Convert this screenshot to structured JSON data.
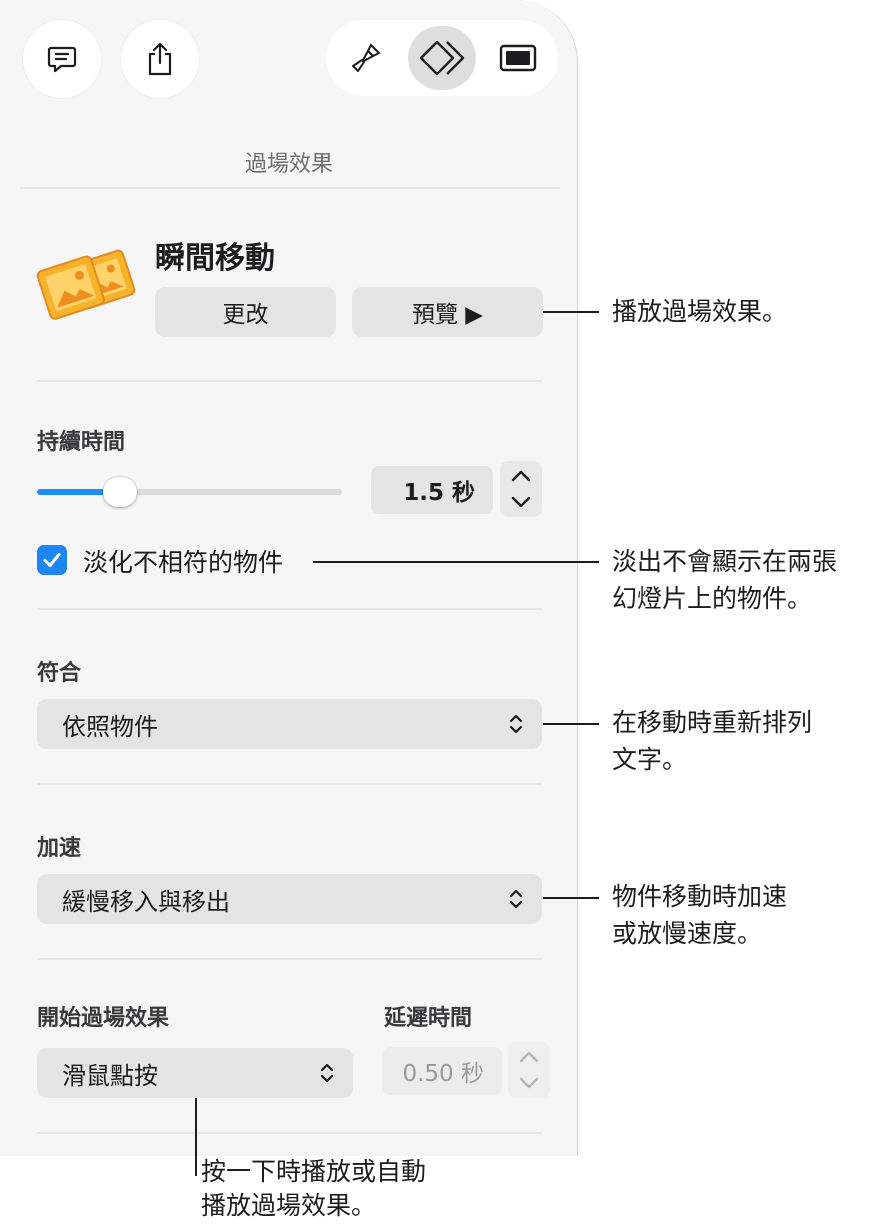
{
  "toolbar": {
    "comment_icon": "comment-icon",
    "share_icon": "share-icon",
    "format_icon": "paintbrush-icon",
    "animate_icon": "animate-diamonds-icon",
    "document_icon": "slide-document-icon"
  },
  "panel": {
    "title": "過場效果",
    "transition_name": "瞬間移動",
    "change_label": "更改",
    "preview_label": "預覽 ▶"
  },
  "duration": {
    "label": "持續時間",
    "value": "1.5 秒",
    "slider_fraction": 0.28
  },
  "fade_checkbox": {
    "label": "淡化不相符的物件",
    "checked": true
  },
  "match": {
    "label": "符合",
    "selected": "依照物件"
  },
  "acceleration": {
    "label": "加速",
    "selected": "緩慢移入與移出"
  },
  "start": {
    "label": "開始過場效果",
    "selected": "滑鼠點按"
  },
  "delay": {
    "label": "延遲時間",
    "value": "0.50 秒"
  },
  "callouts": {
    "preview": "播放過場效果。",
    "fade_line1": "淡出不會顯示在兩張",
    "fade_line2": "幻燈片上的物件。",
    "match_line1": "在移動時重新排列",
    "match_line2": "文字。",
    "accel_line1": "物件移動時加速",
    "accel_line2": "或放慢速度。",
    "start_line1": "按一下時播放或自動",
    "start_line2": "播放過場效果。"
  },
  "colors": {
    "accent": "#1d86f2",
    "icon_orange": "#f5a623"
  }
}
